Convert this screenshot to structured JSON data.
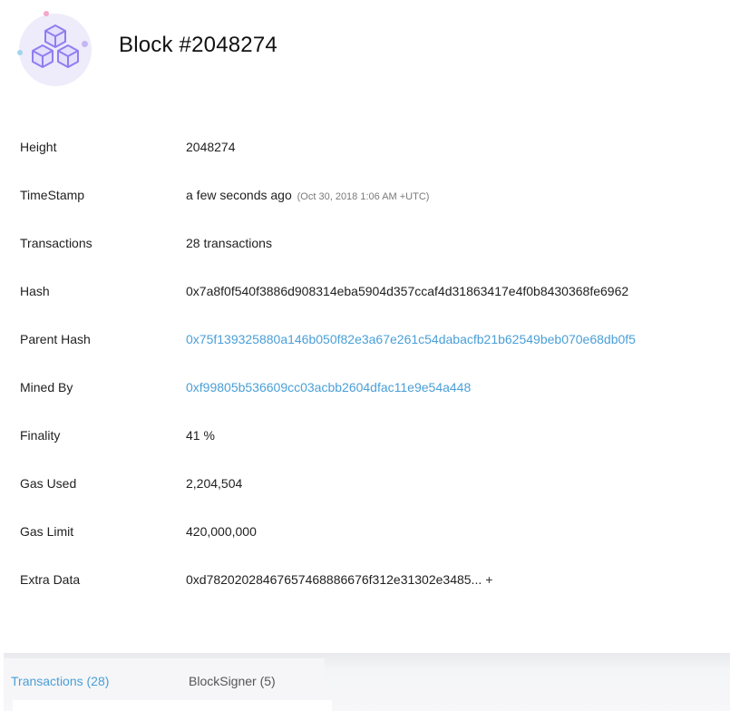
{
  "header": {
    "title": "Block #2048274",
    "logo_icon": "blocks-cube-icon"
  },
  "details": [
    {
      "label": "Height",
      "value": "2048274"
    },
    {
      "label": "TimeStamp",
      "value": "a few seconds ago",
      "sub": "(Oct 30, 2018 1:06 AM +UTC)"
    },
    {
      "label": "Transactions",
      "value": "28 transactions"
    },
    {
      "label": "Hash",
      "value": "0x7a8f0f540f3886d908314eba5904d357ccaf4d31863417e4f0b8430368fe6962"
    },
    {
      "label": "Parent Hash",
      "value": "0x75f139325880a146b050f82e3a67e261c54dabacfb21b62549beb070e68db0f5"
    },
    {
      "label": "Mined By",
      "value": "0xf99805b536609cc03acbb2604dfac11e9e54a448"
    },
    {
      "label": "Finality",
      "value": "41 %"
    },
    {
      "label": "Gas Used",
      "value": "2,204,504"
    },
    {
      "label": "Gas Limit",
      "value": "420,000,000"
    },
    {
      "label": "Extra Data",
      "value": "0xd78202028467657468886676f312e31302e3485...",
      "expand": "+"
    }
  ],
  "tabs": [
    {
      "label": "Transactions (28)",
      "active": true
    },
    {
      "label": "BlockSigner (5)",
      "active": false
    }
  ],
  "colors": {
    "link": "#4a9fd8",
    "logo_bg": "#eeebfb",
    "logo_stroke": "#8f7ef0"
  }
}
